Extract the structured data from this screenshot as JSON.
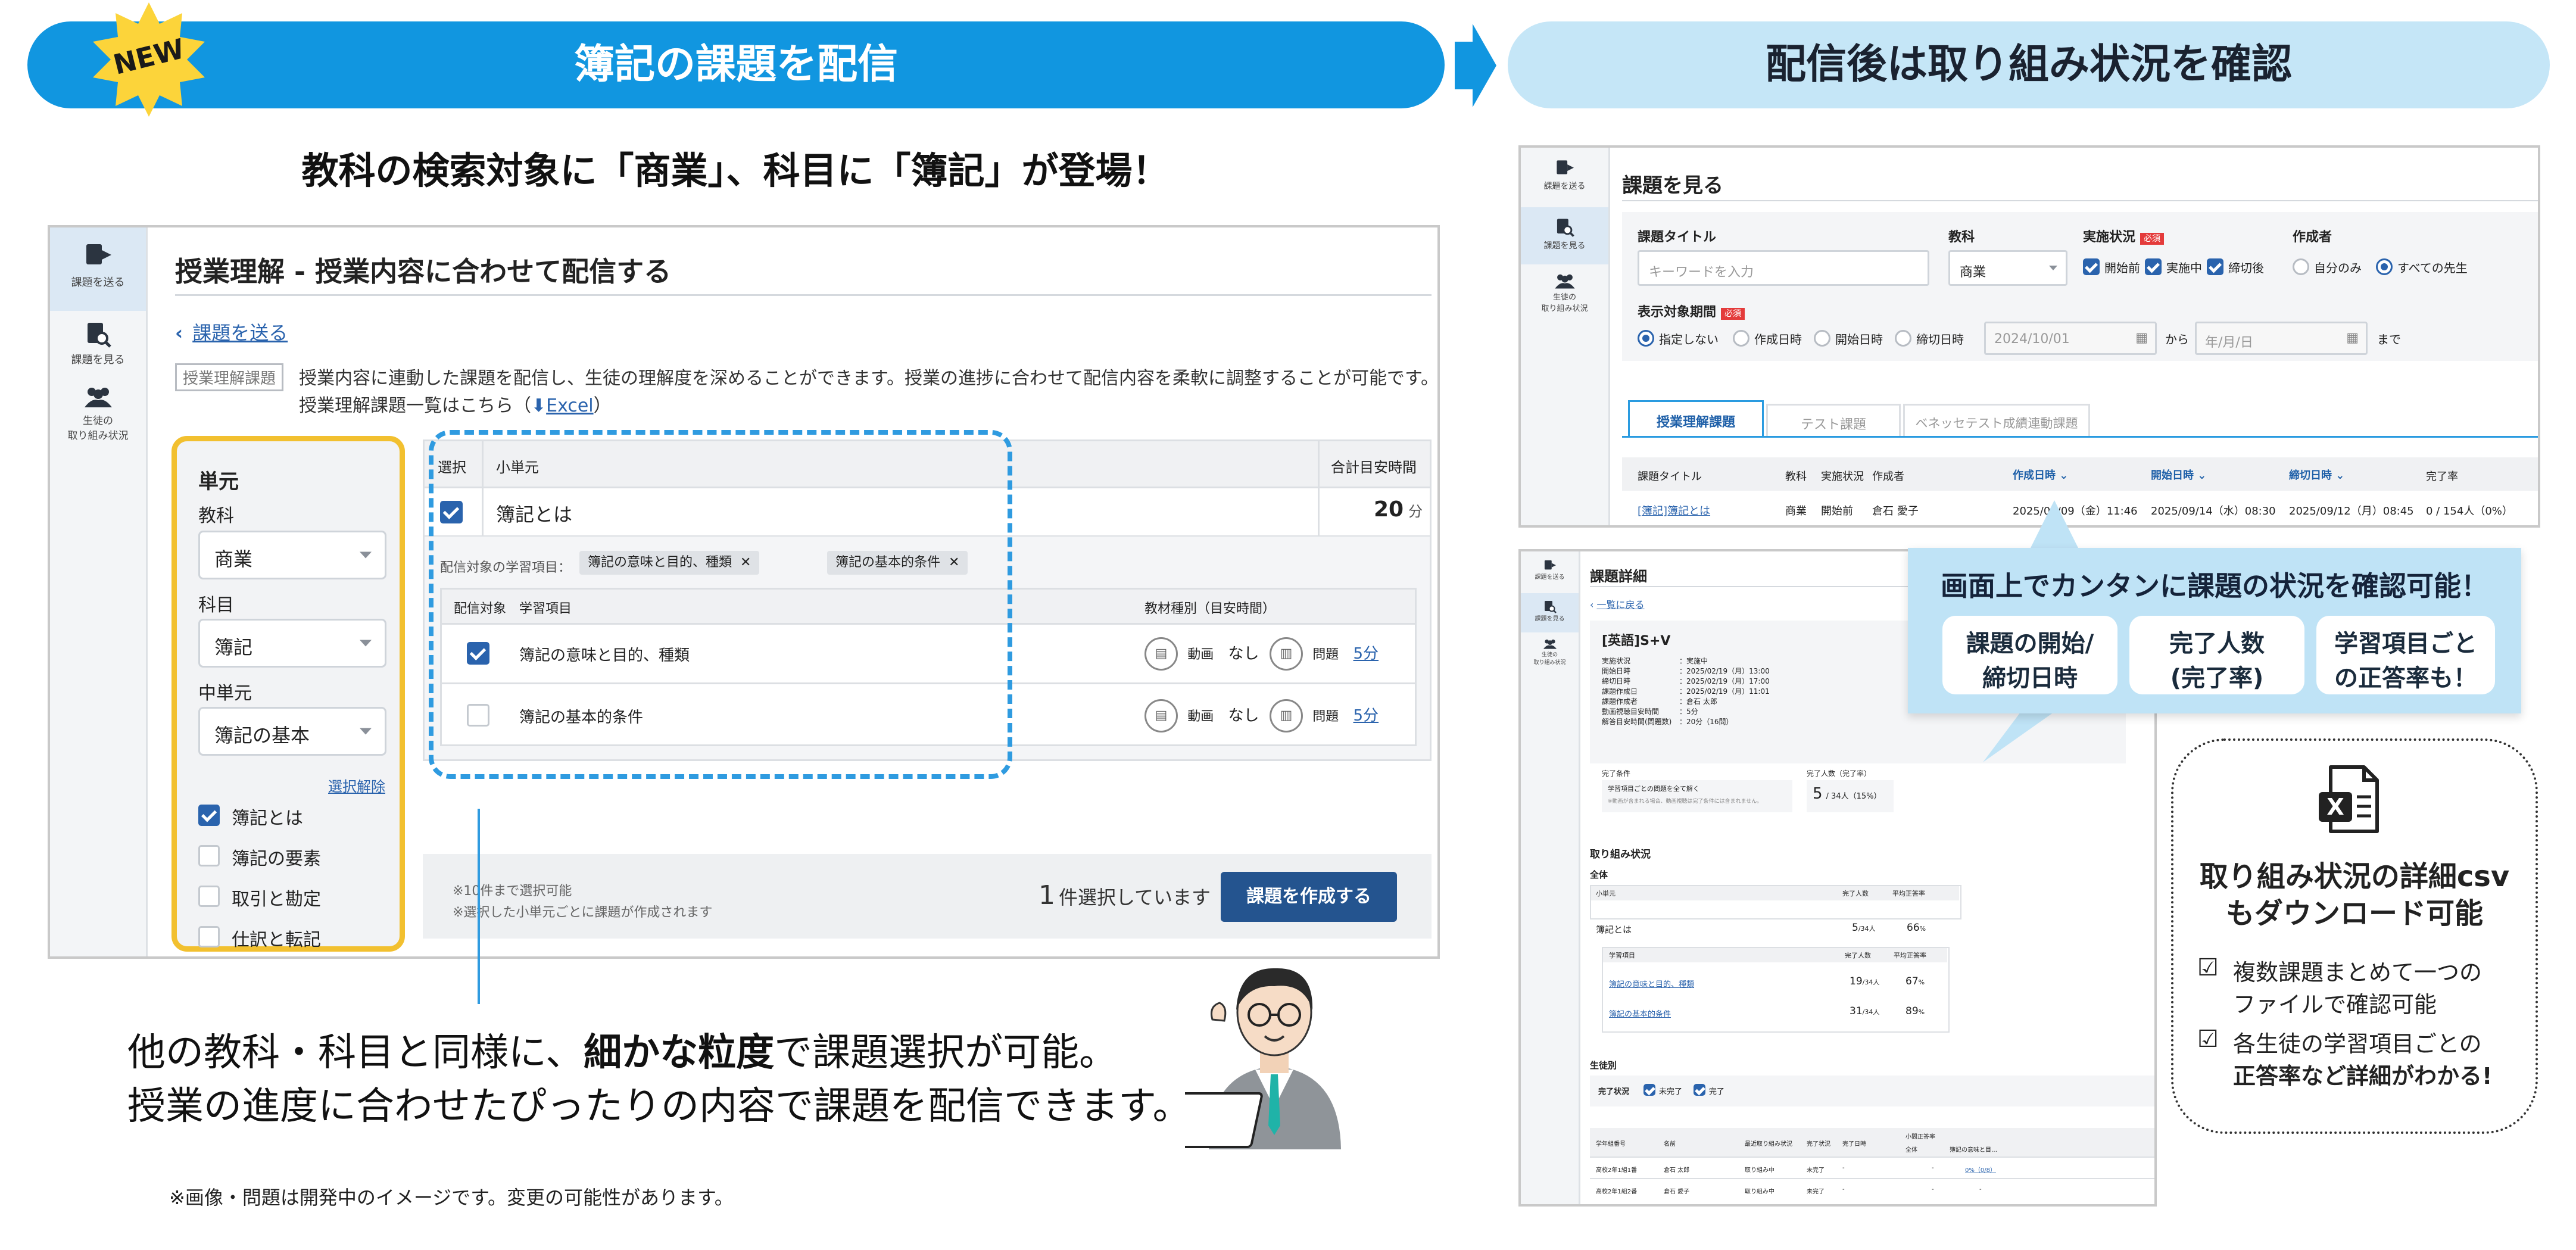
{
  "banner": {
    "new_badge": "NEW",
    "left_title": "簿記の課題を配信",
    "right_title": "配信後は取り組み状況を確認"
  },
  "left": {
    "headline": "教科の検索対象に「商業」、科目に「簿記」が登場！",
    "sidebar": {
      "send": "課題を送る",
      "view": "課題を見る",
      "status_line1": "生徒の",
      "status_line2": "取り組み状況"
    },
    "page_title": "授業理解 - 授業内容に合わせて配信する",
    "back_link": "課題を送る",
    "type_tag": "授業理解課題",
    "description_line1": "授業内容に連動した課題を配信し、生徒の理解度を深めることができます。授業の進捗に合わせて配信内容を柔軟に調整することが可能です。",
    "description_line2_prefix": "授業理解課題一覧はこちら（",
    "description_link": "Excel",
    "description_line2_suffix": "）",
    "filter": {
      "heading": "単元",
      "subject_label": "教科",
      "subject_value": "商業",
      "course_label": "科目",
      "course_value": "簿記",
      "unit_label": "中単元",
      "unit_value": "簿記の基本",
      "clear_link": "選択解除",
      "items": [
        {
          "label": "簿記とは",
          "checked": true
        },
        {
          "label": "簿記の要素",
          "checked": false
        },
        {
          "label": "取引と勘定",
          "checked": false
        },
        {
          "label": "仕訳と転記",
          "checked": false
        }
      ]
    },
    "table": {
      "col_select": "選択",
      "col_subunit": "小単元",
      "col_total": "合計目安時間",
      "row_title": "簿記とは",
      "row_total": "20",
      "row_total_unit": "分",
      "items_label": "配信対象の学習項目：",
      "chips": [
        "簿記の意味と目的、種類",
        "簿記の基本的条件"
      ],
      "sub_col_target": "配信対象",
      "sub_col_item": "学習項目",
      "sub_col_kind": "教材種別（目安時間）",
      "sub_rows": [
        {
          "label": "簿記の意味と目的、種類",
          "checked": true,
          "video": "動画",
          "video_val": "なし",
          "quiz": "問題",
          "quiz_val": "5分"
        },
        {
          "label": "簿記の基本的条件",
          "checked": false,
          "video": "動画",
          "video_val": "なし",
          "quiz": "問題",
          "quiz_val": "5分"
        }
      ]
    },
    "footer": {
      "note1": "※10件まで選択可能",
      "note2": "※選択した小単元ごとに課題が作成されます",
      "count": "1",
      "count_suffix": "件選択しています",
      "create_button": "課題を作成する"
    },
    "caption_line1_a": "他の教科・科目と同様に、",
    "caption_line1_b": "細かな粒度",
    "caption_line1_c": "で課題選択が可能。",
    "caption_line2": "授業の進度に合わせたぴったりの内容で課題を配信できます。",
    "disclaimer": "※画像・問題は開発中のイメージです。変更の可能性があります。"
  },
  "right_top": {
    "sidebar": {
      "send": "課題を送る",
      "view": "課題を見る",
      "status_line1": "生徒の",
      "status_line2": "取り組み状況"
    },
    "title": "課題を見る",
    "f_title_label": "課題タイトル",
    "f_title_placeholder": "キーワードを入力",
    "f_subject_label": "教科",
    "f_subject_value": "商業",
    "f_status_label": "実施状況",
    "required": "必須",
    "status_options": [
      "開始前",
      "実施中",
      "締切後"
    ],
    "f_author_label": "作成者",
    "author_options": [
      "自分のみ",
      "すべての先生"
    ],
    "period_label": "表示対象期間",
    "period_options": [
      "指定しない",
      "作成日時",
      "開始日時",
      "締切日時"
    ],
    "date_from": "2024/10/01",
    "from_word": "から",
    "date_to_placeholder": "年/月/日",
    "to_word": "まで",
    "tabs": [
      "授業理解課題",
      "テスト課題",
      "ベネッセテスト成績連動課題"
    ],
    "table_headers": [
      "課題タイトル",
      "教科",
      "実施状況",
      "作成者",
      "作成日時",
      "開始日時",
      "締切日時",
      "完了率"
    ],
    "row": [
      "[簿記]簿記とは",
      "商業",
      "開始前",
      "倉石 愛子",
      "2025/09/09（金）11:46",
      "2025/09/14（水）08:30",
      "2025/09/12（月）08:45",
      "0 / 154人（0%）"
    ]
  },
  "right_bottom": {
    "sidebar": {
      "send": "課題を送る",
      "view": "課題を見る",
      "status_line1": "生徒の",
      "status_line2": "取り組み状況"
    },
    "title": "課題詳細",
    "back": "一覧に戻る",
    "task_name": "[英語]S+V",
    "meta": [
      [
        "実施状況",
        "：実施中"
      ],
      [
        "開始日時",
        "：2025/02/19（月）13:00"
      ],
      [
        "締切日時",
        "：2025/02/19（月）17:00"
      ],
      [
        "課題作成日",
        "：2025/02/19（月）11:01"
      ],
      [
        "課題作成者",
        "：倉石 太郎"
      ],
      [
        "動画視聴目安時間",
        "：5分"
      ],
      [
        "解答目安時間(問題数)",
        "：20分（16問）"
      ]
    ],
    "cond_label": "完了条件",
    "cond_text1": "学習項目ごとの問題を全て解く",
    "cond_text2": "※動画が含まれる場合、動画視聴は完了条件には含まれません。",
    "done_label": "完了人数（完了率）",
    "done_value": "5",
    "done_suffix": "/ 34人（15%）",
    "progress_title": "取り組み状況",
    "overall": "全体",
    "sum_headers": [
      "小単元",
      "完了人数",
      "平均正答率"
    ],
    "sum_row": [
      "簿記とは",
      "5",
      "/34人",
      "66",
      "%"
    ],
    "item_headers": [
      "学習項目",
      "完了人数",
      "平均正答率"
    ],
    "item_rows": [
      [
        "簿記の意味と目的、種類",
        "19",
        "/34人",
        "67",
        "%"
      ],
      [
        "簿記の基本的条件",
        "31",
        "/34人",
        "89",
        "%"
      ]
    ],
    "by_student": "生徒別",
    "done_status": "完了状況",
    "not_done": "未完了",
    "done": "完了",
    "stu_headers": [
      "学年組番号",
      "名前",
      "最近取り組み状況",
      "完了状況",
      "完了日時",
      "小問正答率",
      "全体",
      "簿記の意味と目…"
    ],
    "stu_rows": [
      [
        "高校2年1組1番",
        "倉石 太郎",
        "取り組み中",
        "未完了",
        "-",
        "-",
        "0%（0/8）"
      ],
      [
        "高校2年1組2番",
        "倉石 愛子",
        "取り組み中",
        "未完了",
        "-",
        "-",
        "-"
      ]
    ]
  },
  "callout": {
    "title": "画面上でカンタンに課題の状況を確認可能！",
    "b1_line1": "課題の開始/",
    "b1_line2": "締切日時",
    "b2_line1": "完了人数",
    "b2_line2": "(完了率)",
    "b3_line1": "学習項目ごと",
    "b3_line2": "の正答率も！"
  },
  "csv_box": {
    "title_line1": "取り組み状況の詳細csv",
    "title_line2": "もダウンロード可能",
    "item1_line1": "複数課題まとめて一つの",
    "item1_line2": "ファイルで確認可能",
    "item2_line1": "各生徒の学習項目ごとの",
    "item2_line2": "正答率など詳細がわかる!"
  },
  "colors": {
    "brand_blue": "#1196e0",
    "light_blue": "#c5e6f7",
    "callout_blue": "#bfe3f6",
    "gold": "#f2c02f",
    "dashed_blue": "#2f9be0",
    "button_blue": "#24548f"
  }
}
